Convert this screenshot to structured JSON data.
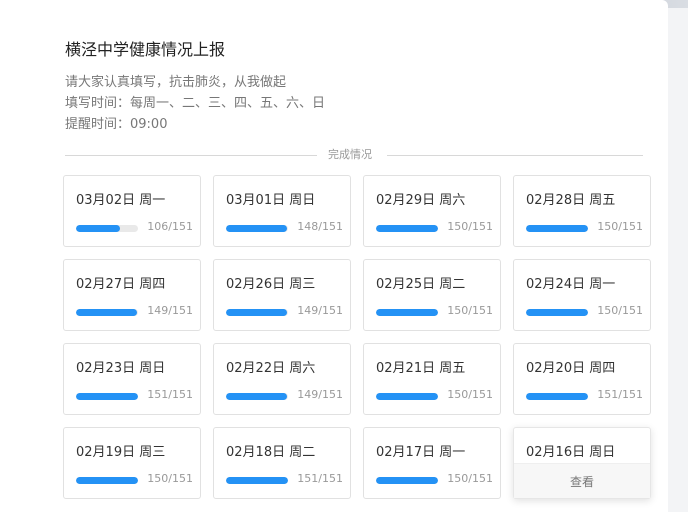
{
  "form": {
    "title": "横泾中学健康情况上报",
    "desc": [
      "请大家认真填写，抗击肺炎，从我做起",
      "填写时间：每周一、二、三、四、五、六、日",
      "提醒时间：09:00"
    ],
    "section_label": "完成情况"
  },
  "tiles": [
    {
      "date": "03月02日 周一",
      "count": "106/151",
      "progress": 0.702
    },
    {
      "date": "03月01日 周日",
      "count": "148/151",
      "progress": 0.98
    },
    {
      "date": "02月29日 周六",
      "count": "150/151",
      "progress": 0.993
    },
    {
      "date": "02月28日 周五",
      "count": "150/151",
      "progress": 0.993
    },
    {
      "date": "02月27日 周四",
      "count": "149/151",
      "progress": 0.987
    },
    {
      "date": "02月26日 周三",
      "count": "149/151",
      "progress": 0.987
    },
    {
      "date": "02月25日 周二",
      "count": "150/151",
      "progress": 0.993
    },
    {
      "date": "02月24日 周一",
      "count": "150/151",
      "progress": 0.993
    },
    {
      "date": "02月23日 周日",
      "count": "151/151",
      "progress": 1.0
    },
    {
      "date": "02月22日 周六",
      "count": "149/151",
      "progress": 0.987
    },
    {
      "date": "02月21日 周五",
      "count": "150/151",
      "progress": 0.993
    },
    {
      "date": "02月20日 周四",
      "count": "151/151",
      "progress": 1.0
    },
    {
      "date": "02月19日 周三",
      "count": "150/151",
      "progress": 0.993
    },
    {
      "date": "02月18日 周二",
      "count": "151/151",
      "progress": 1.0
    },
    {
      "date": "02月17日 周一",
      "count": "150/151",
      "progress": 0.993
    },
    {
      "date": "02月16日 周日",
      "view_label": "查看",
      "hover": true
    }
  ],
  "colors": {
    "accent": "#2492f5",
    "track": "#e9e9e9"
  }
}
